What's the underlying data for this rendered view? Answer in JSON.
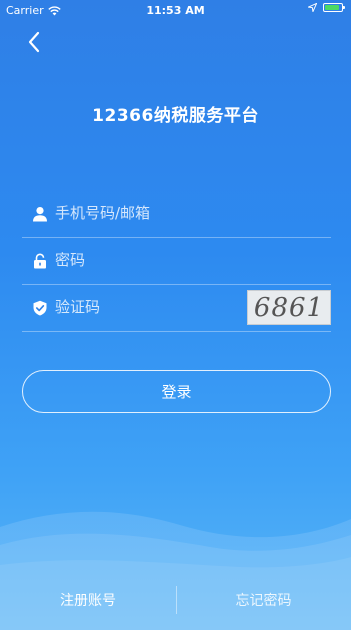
{
  "status_bar": {
    "carrier": "Carrier",
    "time": "11:53 AM",
    "battery_level": 0.9
  },
  "header": {
    "title": "12366纳税服务平台"
  },
  "form": {
    "phone_placeholder": "手机号码/邮箱",
    "password_placeholder": "密码",
    "captcha_placeholder": "验证码",
    "captcha_text": "6861",
    "login_label": "登录"
  },
  "footer": {
    "register_label": "注册账号",
    "forgot_label": "忘记密码"
  },
  "icons": {
    "back": "chevron-left-icon",
    "user": "user-icon",
    "lock": "lock-icon",
    "shield": "shield-check-icon"
  }
}
